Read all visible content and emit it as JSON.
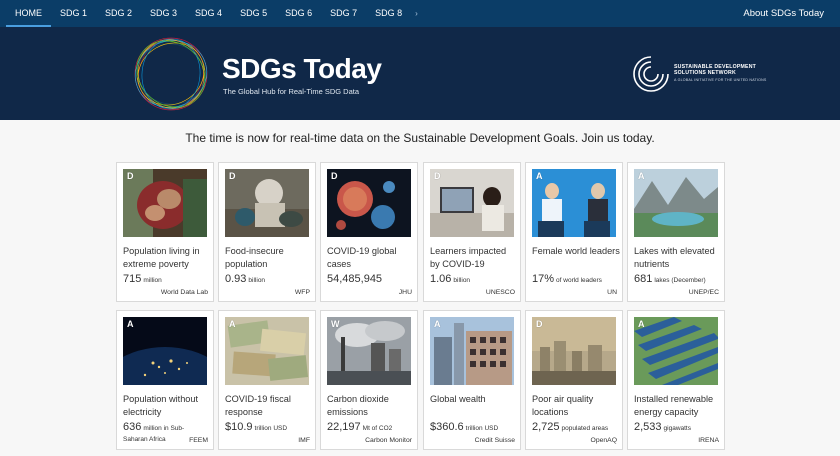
{
  "nav": {
    "items": [
      "HOME",
      "SDG 1",
      "SDG 2",
      "SDG 3",
      "SDG 4",
      "SDG 5",
      "SDG 6",
      "SDG 7",
      "SDG 8"
    ],
    "more": "›",
    "about": "About SDGs Today"
  },
  "banner": {
    "title": "SDGs Today",
    "subtitle": "The Global Hub for Real-Time SDG Data",
    "partner_line1": "SUSTAINABLE DEVELOPMENT",
    "partner_line2": "SOLUTIONS NETWORK",
    "partner_line3": "A GLOBAL INITIATIVE FOR THE UNITED NATIONS"
  },
  "tagline": "The time is now for real-time data on the Sustainable Development Goals. Join us today.",
  "cards": [
    {
      "grade": "D",
      "title": "Population living in extreme poverty",
      "value": "715",
      "unit": "million",
      "source": "World Data Lab",
      "image": "poverty-photo"
    },
    {
      "grade": "D",
      "title": "Food-insecure population",
      "value": "0.93",
      "unit": "billion",
      "source": "WFP",
      "image": "food-insecurity-photo"
    },
    {
      "grade": "D",
      "title": "COVID-19 global cases",
      "value": "54,485,945",
      "unit": "",
      "source": "JHU",
      "image": "virus-photo"
    },
    {
      "grade": "D",
      "title": "Learners impacted by COVID-19",
      "value": "1.06",
      "unit": "billion",
      "source": "UNESCO",
      "image": "learner-photo"
    },
    {
      "grade": "A",
      "title": "Female world leaders",
      "value": "17%",
      "unit": "of world leaders",
      "source": "UN",
      "image": "leaders-photo"
    },
    {
      "grade": "A",
      "title": "Lakes with elevated nutrients",
      "value": "681",
      "unit": "lakes (December)",
      "source": "UNEP/EC",
      "image": "lake-photo"
    },
    {
      "grade": "A",
      "title": "Population without electricity",
      "value": "636",
      "unit": "million in Sub-Saharan Africa",
      "source": "FEEM",
      "image": "night-earth-photo"
    },
    {
      "grade": "A",
      "title": "COVID-19 fiscal response",
      "value": "$10.9",
      "unit": "trillion USD",
      "source": "IMF",
      "image": "currency-photo"
    },
    {
      "grade": "W",
      "title": "Carbon dioxide emissions",
      "value": "22,197",
      "unit": "Mt of CO2",
      "source": "Carbon Monitor",
      "image": "power-plant-photo"
    },
    {
      "grade": "A",
      "title": "Global wealth",
      "value": "$360.6",
      "unit": "trillion USD",
      "source": "Credit Suisse",
      "image": "buildings-photo"
    },
    {
      "grade": "D",
      "title": "Poor air quality locations",
      "value": "2,725",
      "unit": "populated areas",
      "source": "OpenAQ",
      "image": "smog-photo"
    },
    {
      "grade": "A",
      "title": "Installed renewable energy capacity",
      "value": "2,533",
      "unit": "gigawatts",
      "source": "IRENA",
      "image": "solar-photo"
    }
  ]
}
